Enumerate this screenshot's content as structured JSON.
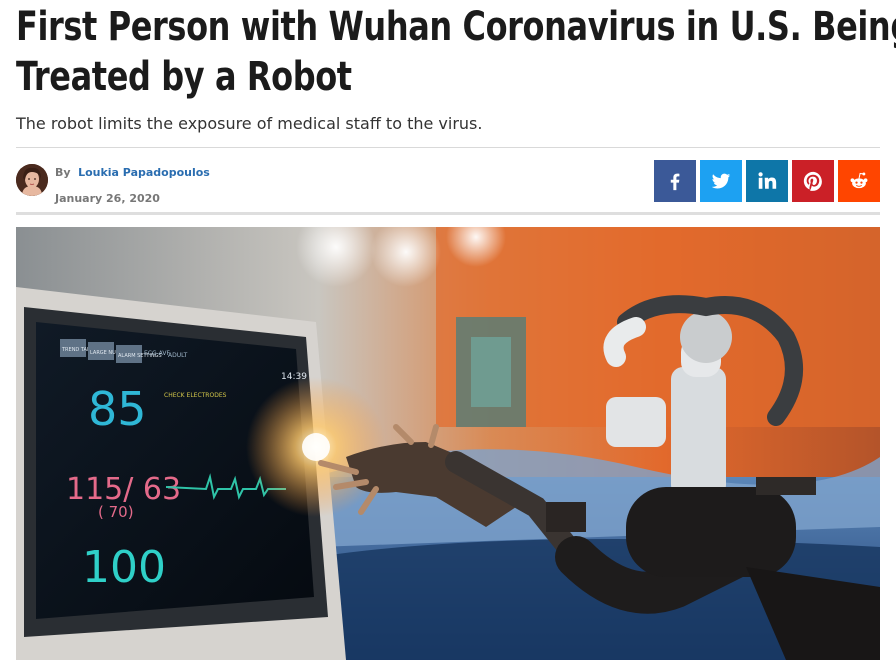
{
  "article": {
    "headline_line1": "First Person with Wuhan Coronavirus in U.S. Being",
    "headline_line2": "Treated by a Robot",
    "subtitle": "The robot limits the exposure of medical staff to the virus."
  },
  "byline": {
    "by_label": "By",
    "author": "Loukia Papadopoulos",
    "date": "January 26, 2020"
  },
  "share": [
    {
      "network": "facebook",
      "icon": "facebook-icon",
      "color": "#3b5998"
    },
    {
      "network": "twitter",
      "icon": "twitter-icon",
      "color": "#1da1f2"
    },
    {
      "network": "linkedin",
      "icon": "linkedin-icon",
      "color": "#0e76a8"
    },
    {
      "network": "pinterest",
      "icon": "pinterest-icon",
      "color": "#cb2027"
    },
    {
      "network": "reddit",
      "icon": "reddit-icon",
      "color": "#ff4500"
    }
  ],
  "hero_image": {
    "monitor": {
      "tabs": [
        "TREND TABLE",
        "LARGE NUMBERS",
        "ALARM SETTINGS",
        "ECG-AVF",
        "ADULT"
      ],
      "time": "14:39",
      "heart_rate": "85",
      "check_label": "CHECK ELECTRODES",
      "bp": "115/ 63",
      "bp_mean": "( 70)",
      "spo2": "100"
    }
  }
}
